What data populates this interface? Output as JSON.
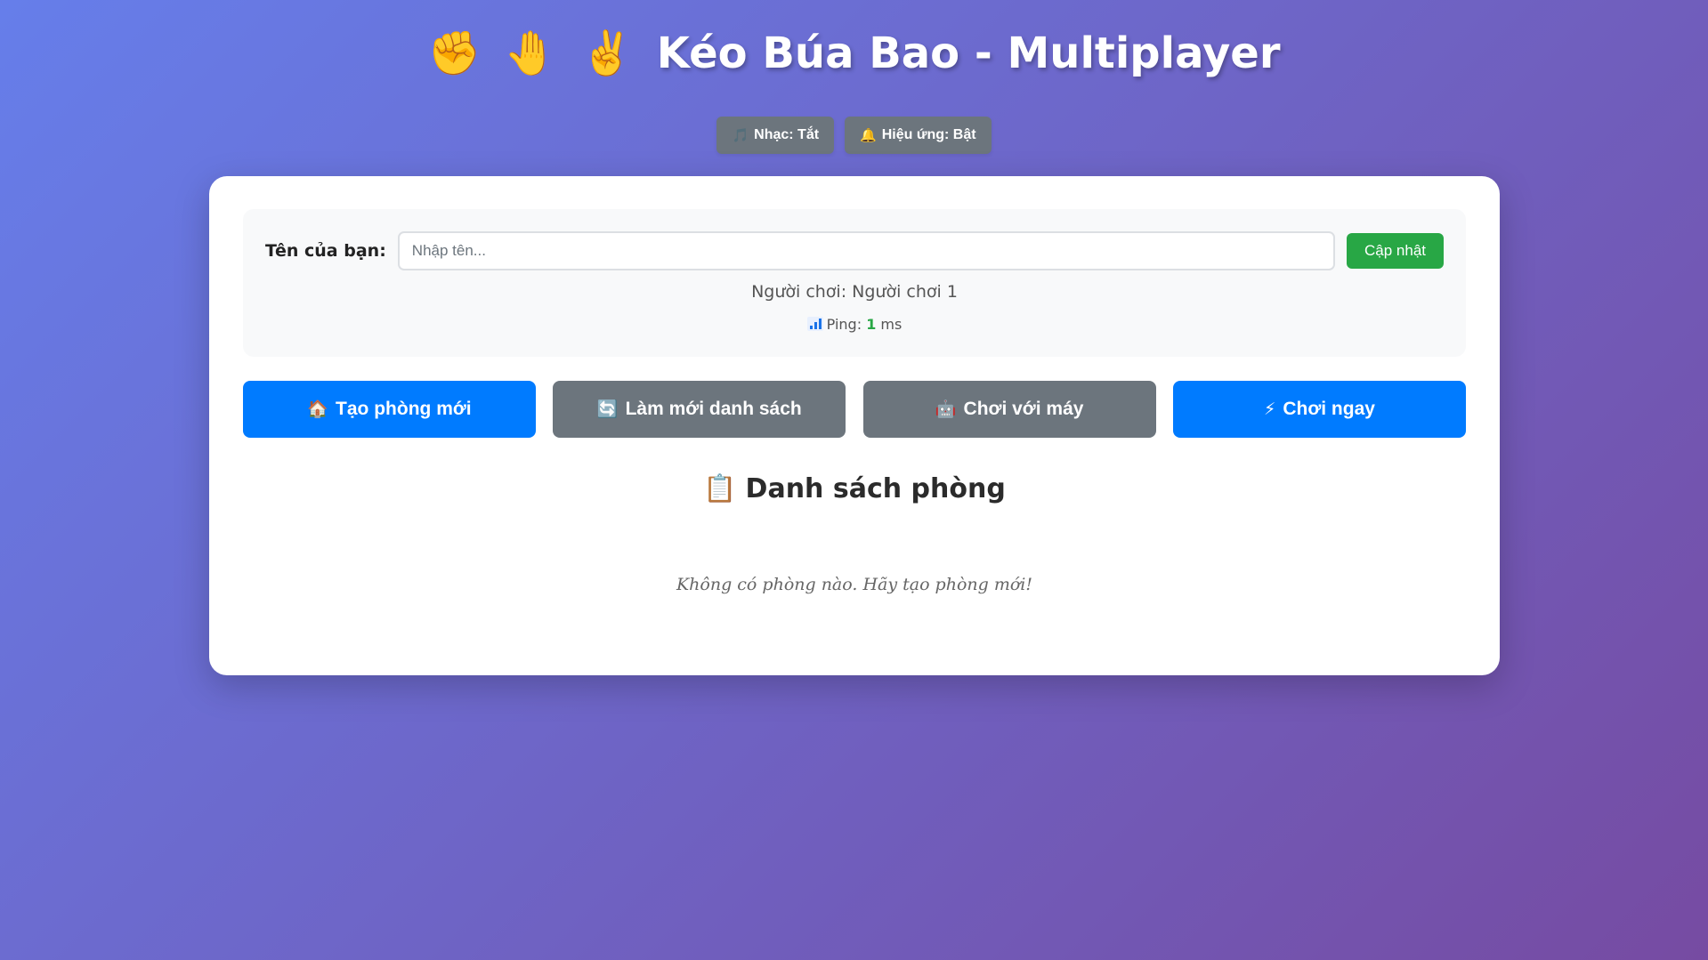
{
  "header": {
    "icons": [
      "✊",
      "🤚",
      "✌️"
    ],
    "title": "Kéo Búa Bao - Multiplayer"
  },
  "settings": {
    "music": {
      "icon": "🎵",
      "label": "Nhạc: Tắt"
    },
    "effects": {
      "icon": "🔔",
      "label": "Hiệu ứng: Bật"
    }
  },
  "player_panel": {
    "name_label": "Tên của bạn:",
    "name_value": "",
    "name_placeholder": "Nhập tên...",
    "update_label": "Cập nhật",
    "player_status": "Người chơi: Người chơi 1",
    "ping_label": "Ping:",
    "ping_value": "1",
    "ping_unit": "ms"
  },
  "actions": {
    "create_room": {
      "icon": "🏠",
      "label": "Tạo phòng mới"
    },
    "refresh_list": {
      "icon": "🔄",
      "label": "Làm mới danh sách"
    },
    "play_bot": {
      "icon": "🤖",
      "label": "Chơi với máy"
    },
    "quick_play": {
      "icon": "⚡",
      "label": "Chơi ngay"
    }
  },
  "rooms": {
    "icon": "📋",
    "title": "Danh sách phòng",
    "empty_message": "Không có phòng nào. Hãy tạo phòng mới!"
  },
  "colors": {
    "background_start": "#667eea",
    "background_end": "#764ba2",
    "primary": "#007bff",
    "secondary": "#6c757d",
    "success": "#28a745"
  }
}
